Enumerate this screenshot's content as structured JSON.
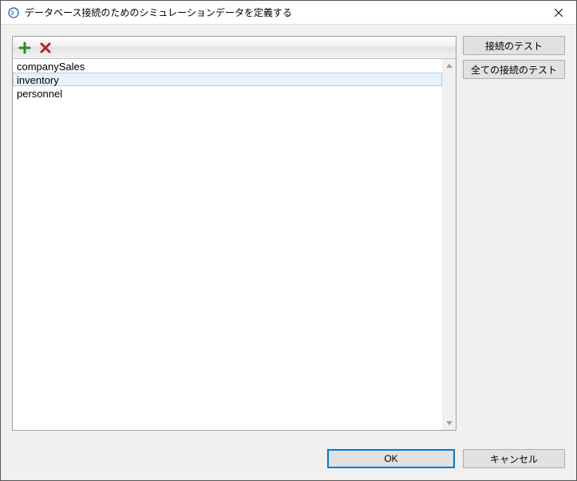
{
  "window": {
    "title": "データベース接続のためのシミュレーションデータを定義する"
  },
  "list": {
    "items": [
      {
        "label": "companySales",
        "selected": false
      },
      {
        "label": "inventory",
        "selected": true
      },
      {
        "label": "personnel",
        "selected": false
      }
    ]
  },
  "sideButtons": {
    "testConnection": "接続のテスト",
    "testAllConnections": "全ての接続のテスト"
  },
  "bottomButtons": {
    "ok": "OK",
    "cancel": "キャンセル"
  }
}
